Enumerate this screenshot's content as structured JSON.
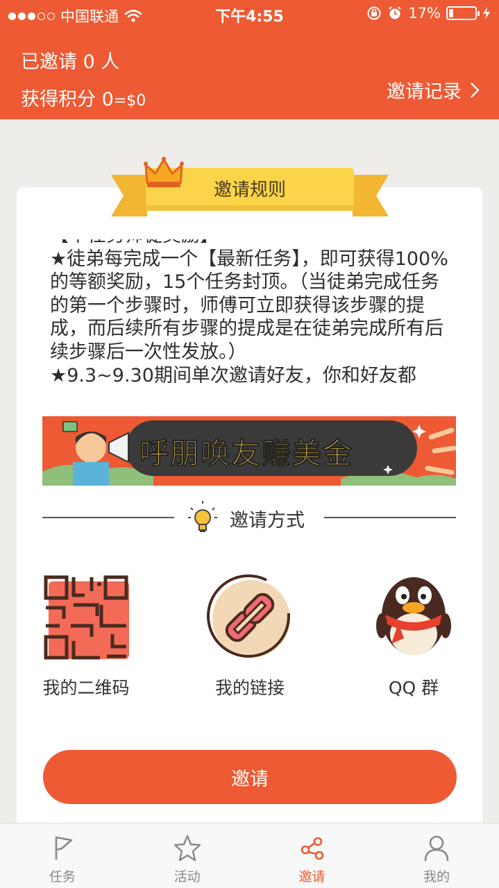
{
  "status_bar": {
    "carrier": "中国联通",
    "time": "下午4:55",
    "battery_percent": "17%",
    "battery_level": 0.17,
    "signal_bars_filled": 3,
    "signal_bars_total": 5
  },
  "header": {
    "invited_count_text": "已邀请 0 人",
    "points_label": "获得积分 0",
    "points_value": "=$0",
    "record_link": "邀请记录"
  },
  "rules": {
    "title": "邀请规则",
    "top_cut_line": "【单任务师徒奖励】",
    "paragraph": "★徒弟每完成一个【最新任务】，即可获得100%的等额奖励，15个任务封顶。（当徒弟完成任务的第一个步骤时，师傅可立即获得该步骤的提成，而后续所有步骤的提成是在徒弟完成所有后续步骤后一次性发放。）",
    "bottom_cut_line": "★9.3~9.30期间单次邀请好友，你和好友都"
  },
  "banner": {
    "text_part1": "呼朋唤友",
    "text_part2": "赚美金"
  },
  "methods": {
    "title": "邀请方式",
    "options": [
      {
        "label": "我的二维码",
        "icon": "qr-code-icon"
      },
      {
        "label": "我的链接",
        "icon": "link-icon"
      },
      {
        "label": "QQ 群",
        "icon": "qq-penguin-icon"
      }
    ]
  },
  "invite_button": "邀请",
  "tabbar": {
    "tabs": [
      {
        "label": "任务",
        "icon": "flag-icon",
        "active": false
      },
      {
        "label": "活动",
        "icon": "star-icon",
        "active": false
      },
      {
        "label": "邀请",
        "icon": "share-icon",
        "active": true
      },
      {
        "label": "我的",
        "icon": "user-icon",
        "active": false
      }
    ]
  },
  "colors": {
    "brand": "#ee5a33",
    "ribbon": "#fbd44a",
    "ribbon_dark": "#f3b632"
  }
}
